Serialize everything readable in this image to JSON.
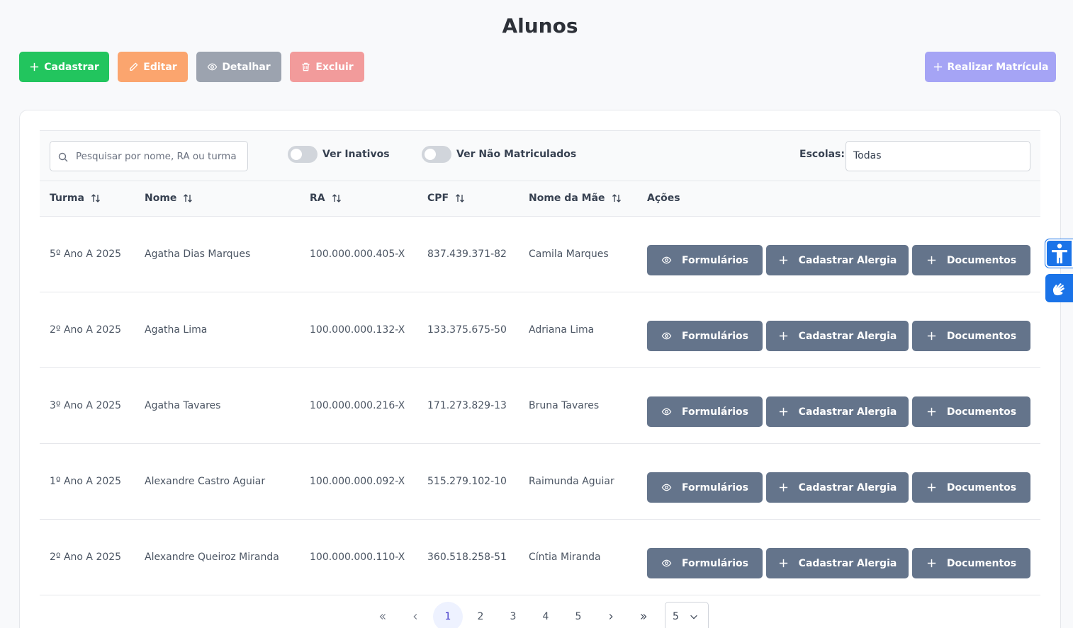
{
  "page": {
    "title": "Alunos"
  },
  "toolbar": {
    "cadastrar": "Cadastrar",
    "editar": "Editar",
    "detalhar": "Detalhar",
    "excluir": "Excluir",
    "matricula": "Realizar Matrícula"
  },
  "filters": {
    "search_placeholder": "Pesquisar por nome, RA ou turma",
    "ver_inativos": "Ver Inativos",
    "ver_nao_matriculados": "Ver Não Matriculados",
    "escolas_label": "Escolas:",
    "escolas_value": "Todas"
  },
  "table": {
    "headers": [
      "Turma",
      "Nome",
      "RA",
      "CPF",
      "Nome da Mãe",
      "Ações"
    ],
    "actions": {
      "formularios": "Formulários",
      "alergia": "Cadastrar Alergia",
      "documentos": "Documentos"
    },
    "rows": [
      {
        "turma": "5º Ano A 2025",
        "nome": "Agatha Dias Marques",
        "ra": "100.000.000.405-X",
        "cpf": "837.439.371-82",
        "mae": "Camila Marques"
      },
      {
        "turma": "2º Ano A 2025",
        "nome": "Agatha Lima",
        "ra": "100.000.000.132-X",
        "cpf": "133.375.675-50",
        "mae": "Adriana Lima"
      },
      {
        "turma": "3º Ano A 2025",
        "nome": "Agatha Tavares",
        "ra": "100.000.000.216-X",
        "cpf": "171.273.829-13",
        "mae": "Bruna Tavares"
      },
      {
        "turma": "1º Ano A 2025",
        "nome": "Alexandre Castro Aguiar",
        "ra": "100.000.000.092-X",
        "cpf": "515.279.102-10",
        "mae": "Raimunda Aguiar"
      },
      {
        "turma": "2º Ano A 2025",
        "nome": "Alexandre Queiroz Miranda",
        "ra": "100.000.000.110-X",
        "cpf": "360.518.258-51",
        "mae": "Cíntia Miranda"
      }
    ]
  },
  "pagination": {
    "pages": [
      "1",
      "2",
      "3",
      "4",
      "5"
    ],
    "current": "1",
    "rows_per_page": "5"
  },
  "colors": {
    "primary_action": "#22c55e",
    "row_action": "#64748b",
    "a11y": "#1a73e8"
  }
}
